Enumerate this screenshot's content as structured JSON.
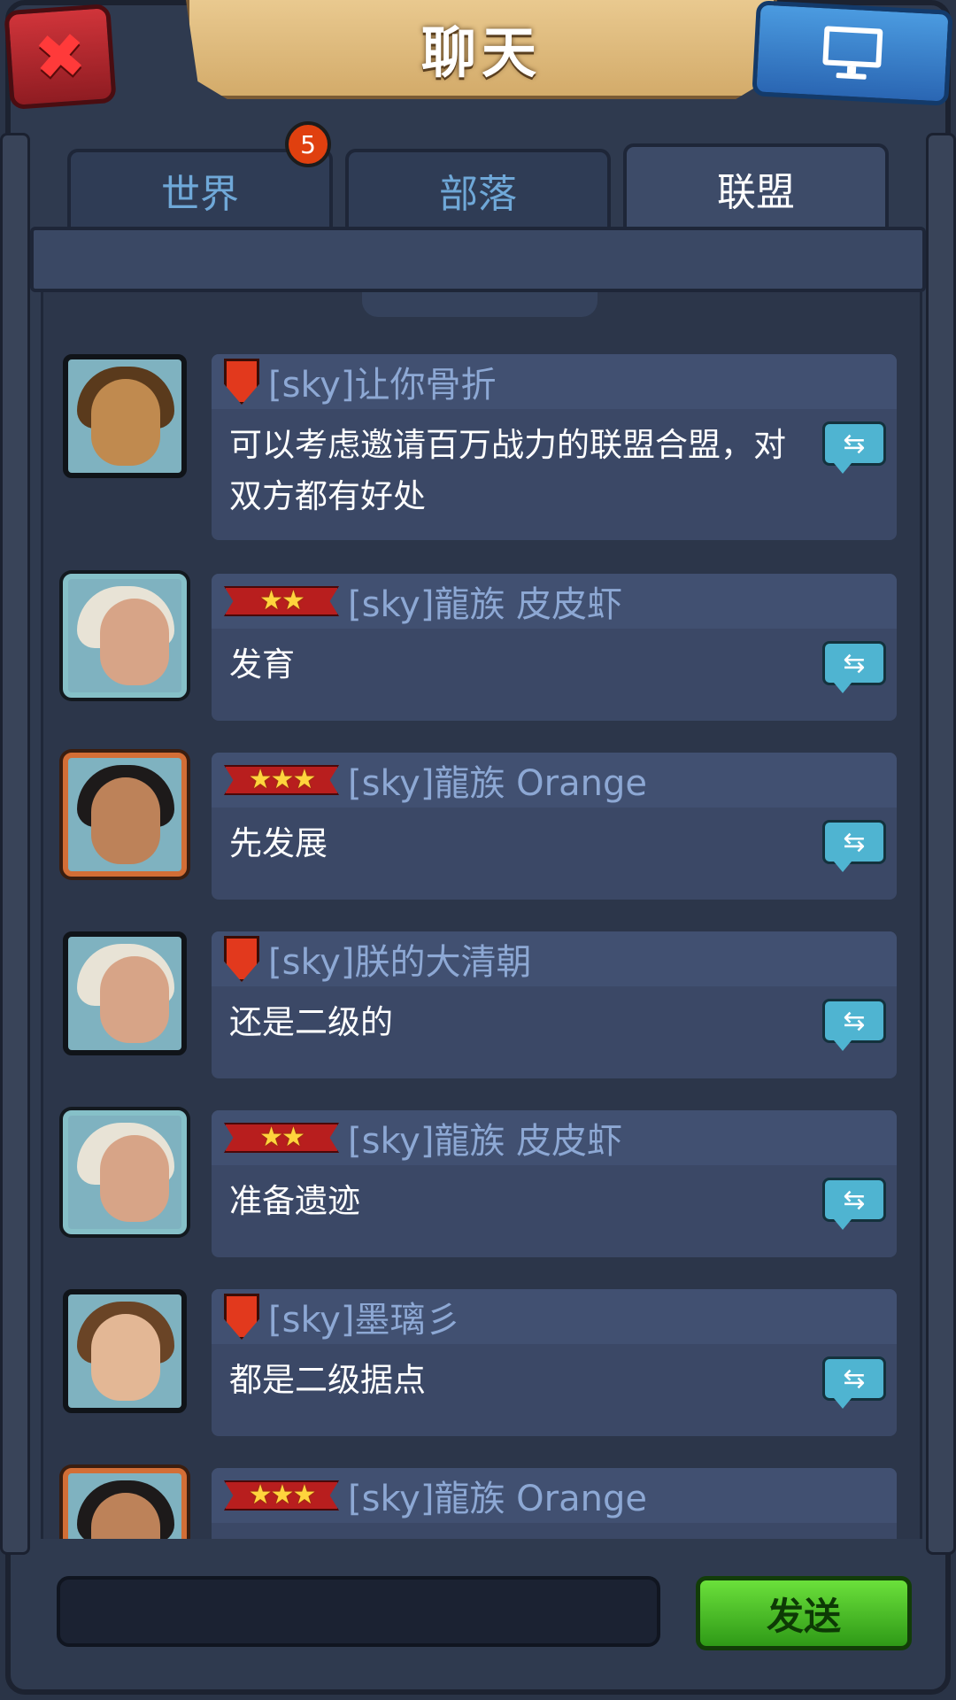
{
  "header": {
    "title": "聊天",
    "close_icon": "close-icon",
    "screen_icon": "monitor-icon"
  },
  "tabs": [
    {
      "label": "世界",
      "badge": "5"
    },
    {
      "label": "部落"
    },
    {
      "label": "联盟",
      "active": true
    }
  ],
  "messages": [
    {
      "rank": "shield",
      "stars": "",
      "name": "[sky]让你骨折",
      "text": "可以考虑邀请百万战力的联盟合盟，对双方都有好处",
      "avatar": "bearded-warrior",
      "frame": "plain"
    },
    {
      "rank": "ribbon",
      "stars": "★★",
      "name": "[sky]龍族 皮皮虾",
      "text": "发育",
      "avatar": "white-hair-woman",
      "frame": "silver"
    },
    {
      "rank": "ribbon",
      "stars": "★★★",
      "name": "[sky]龍族 Orange",
      "text": "先发展",
      "avatar": "dark-hair-man",
      "frame": "gold"
    },
    {
      "rank": "shield",
      "stars": "",
      "name": "[sky]朕的大清朝",
      "text": "还是二级的",
      "avatar": "white-hair-woman",
      "frame": "plain"
    },
    {
      "rank": "ribbon",
      "stars": "★★",
      "name": "[sky]龍族 皮皮虾",
      "text": "准备遗迹",
      "avatar": "white-hair-woman",
      "frame": "silver"
    },
    {
      "rank": "shield",
      "stars": "",
      "name": "[sky]墨璃彡",
      "text": "都是二级据点",
      "avatar": "brown-hair-woman",
      "frame": "plain"
    },
    {
      "rank": "ribbon",
      "stars": "★★★",
      "name": "[sky]龍族 Orange",
      "text": "",
      "avatar": "dark-hair-man",
      "frame": "gold"
    }
  ],
  "translate_glyph": "⇆",
  "input": {
    "value": ""
  },
  "send_label": "发送",
  "colors": {
    "accent_green": "#3fb81f",
    "banner": "#e2c285",
    "panel": "#3b4866",
    "name_text": "#8da8d4"
  }
}
